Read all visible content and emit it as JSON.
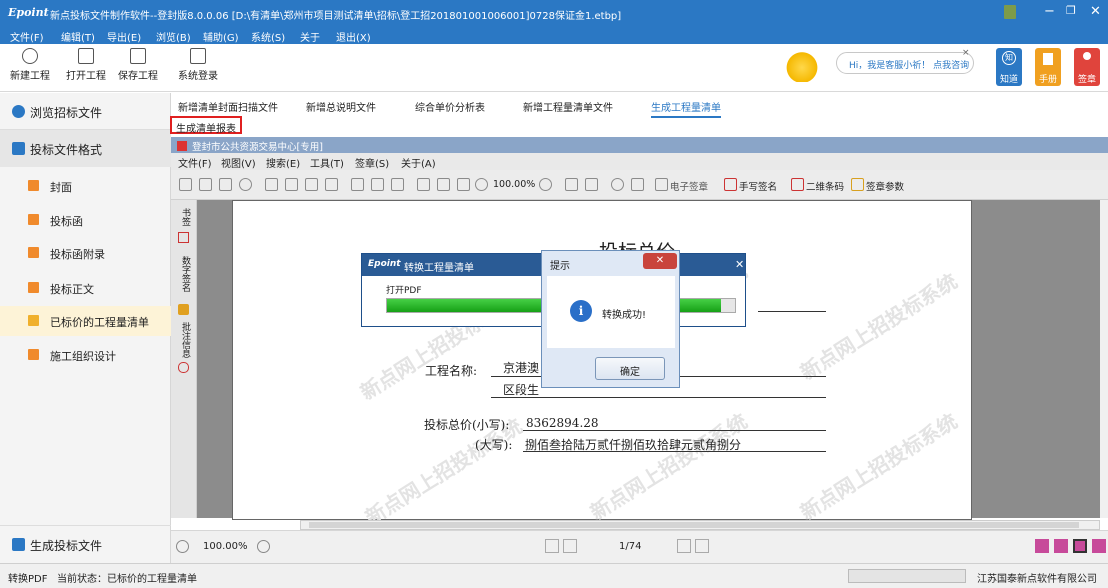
{
  "app": {
    "logo": "Epoint",
    "title": "新点投标文件制作软件--登封版8.0.0.06    [D:\\有清单\\郑州市项目测试清单\\招标\\登工招201801001006001]0728保证金1.etbp]",
    "min": "−",
    "restore": "❐",
    "close": "✕"
  },
  "menu": [
    "文件(F)",
    "编辑(T)",
    "导出(E)",
    "浏览(B)",
    "辅助(G)",
    "系统(S)",
    "关于",
    "退出(X)"
  ],
  "toolbar": {
    "new": "新建工程",
    "open": "打开工程",
    "save": "保存工程",
    "login": "系统登录"
  },
  "help": {
    "text": "Hi，我是客服小祈！ 点我咨询",
    "zhidao": "知道",
    "shouce": "手册",
    "qianzhang": "签章",
    "zhidao_icon": "知"
  },
  "sidebar": {
    "browse": "浏览招标文件",
    "format": "投标文件格式",
    "items": [
      "封面",
      "投标函",
      "投标函附录",
      "投标正文",
      "已标价的工程量清单",
      "施工组织设计"
    ],
    "generate": "生成投标文件"
  },
  "tabs": [
    "新增清单封面扫描文件",
    "新增总说明文件",
    "综合单价分析表",
    "新增工程量清单文件",
    "生成工程量清单"
  ],
  "gen_button": "生成清单报表",
  "pdf": {
    "title": "登封市公共资源交易中心[专用]",
    "menu": [
      "文件(F)",
      "视图(V)",
      "搜索(E)",
      "工具(T)",
      "签章(S)",
      "关于(A)"
    ],
    "zoom": "100.00%",
    "esign": "电子签章",
    "hsign": "手写签名",
    "qrcode": "二维条码",
    "signparam": "签章参数",
    "strip": [
      "书签",
      "数字签名",
      "批注信息"
    ]
  },
  "doc": {
    "heading": "投标总价",
    "proj_label": "工程名称:",
    "proj_value": "京港澳",
    "section": "区段生",
    "price_small_label": "投标总价(小写):",
    "price_small": "8362894.28",
    "price_big_label": "(大写):",
    "price_big": "捌佰叁拾陆万贰仟捌佰玖拾肆元贰角捌分",
    "watermark": "新点网上招投标系统"
  },
  "convert": {
    "logo": "Epoint",
    "title": "转换工程量清单",
    "label": "打开PDF",
    "progress": 0.96
  },
  "msg": {
    "title": "提示",
    "text": "转换成功!",
    "ok": "确定",
    "icon": "i"
  },
  "bottom": {
    "zoom": "100.00%",
    "page": "1/74"
  },
  "status": {
    "left": "转换PDF   当前状态：已标价的工程量清单",
    "company": "江苏国泰新点软件有限公司"
  }
}
